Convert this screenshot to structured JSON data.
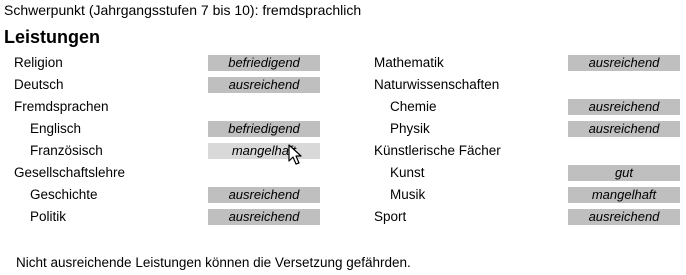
{
  "header": {
    "label": "Schwerpunkt (Jahrgangsstufen 7 bis 10):",
    "value": "fremdsprachlich"
  },
  "section_title": "Leistungen",
  "left_column": [
    {
      "subject": "Religion",
      "grade": "befriedigend"
    },
    {
      "subject": "Deutsch",
      "grade": "ausreichend"
    },
    {
      "subject": "Fremdsprachen",
      "grade": null
    },
    {
      "subject": "Englisch",
      "grade": "befriedigend",
      "indent": true
    },
    {
      "subject": "Französisch",
      "grade": "mangelhaft",
      "indent": true
    },
    {
      "subject": "Gesellschaftslehre",
      "grade": null
    },
    {
      "subject": "Geschichte",
      "grade": "ausreichend",
      "indent": true
    },
    {
      "subject": "Politik",
      "grade": "ausreichend",
      "indent": true
    }
  ],
  "right_column": [
    {
      "subject": "Mathematik",
      "grade": "ausreichend"
    },
    {
      "subject": "Naturwissenschaften",
      "grade": null
    },
    {
      "subject": "Chemie",
      "grade": "ausreichend",
      "indent": true
    },
    {
      "subject": "Physik",
      "grade": "ausreichend",
      "indent": true
    },
    {
      "subject": "Künstlerische Fächer",
      "grade": null
    },
    {
      "subject": "Kunst",
      "grade": "gut",
      "indent": true
    },
    {
      "subject": "Musik",
      "grade": "mangelhaft",
      "indent": true
    },
    {
      "subject": "Sport",
      "grade": "ausreichend"
    }
  ],
  "footer_note": "Nicht ausreichende Leistungen können die Versetzung gefährden.",
  "colors": {
    "grade_field": "#bfbfbf",
    "grade_field_hover": "#d9d9d9"
  },
  "icons": {
    "cursor": "mouse-pointer-icon"
  }
}
